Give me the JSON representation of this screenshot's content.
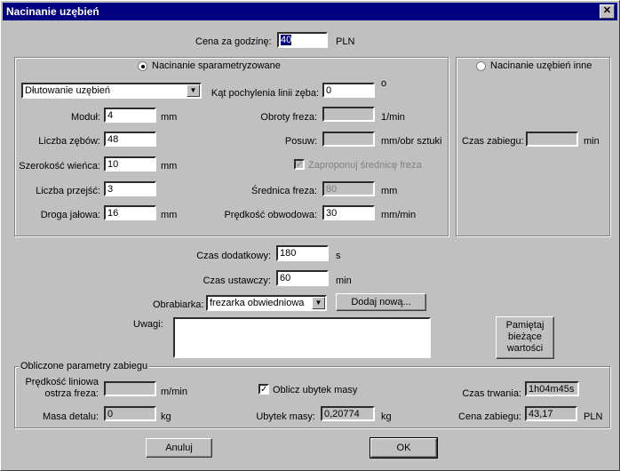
{
  "window": {
    "title": "Nacinanie uzębień",
    "close_glyph": "✕"
  },
  "cena": {
    "label": "Cena za godzinę:",
    "value": "40",
    "unit": "PLN"
  },
  "param_group": {
    "radio_label": "Nacinanie sparametryzowane",
    "method": "Dłutowanie uzębień",
    "kat_label": "Kąt pochylenia linii zęba:",
    "kat_value": "0",
    "kat_unit": "o",
    "modul_label": "Moduł:",
    "modul_value": "4",
    "modul_unit": "mm",
    "obroty_label": "Obroty freza:",
    "obroty_value": "",
    "obroty_unit": "1/min",
    "liczba_zebow_label": "Liczba zębów:",
    "liczba_zebow_value": "48",
    "posuw_label": "Posuw:",
    "posuw_value": "",
    "posuw_unit": "mm/obr sztuki",
    "szerokosc_label": "Szerokość wieńca:",
    "szerokosc_value": "10",
    "szerokosc_unit": "mm",
    "zaproponuj_label": "Zaproponuj średnicę freza",
    "przejsc_label": "Liczba przejść:",
    "przejsc_value": "3",
    "srednica_label": "Średnica freza:",
    "srednica_value": "80",
    "srednica_unit": "mm",
    "droga_label": "Droga jałowa:",
    "droga_value": "16",
    "droga_unit": "mm",
    "predkosc_label": "Prędkość obwodowa:",
    "predkosc_value": "30",
    "predkosc_unit": "mm/min"
  },
  "other_group": {
    "radio_label": "Nacinanie uzębień inne",
    "czas_label": "Czas zabiegu:",
    "czas_value": "",
    "czas_unit": "min"
  },
  "middle": {
    "dodatkowy_label": "Czas dodatkowy:",
    "dodatkowy_value": "180",
    "dodatkowy_unit": "s",
    "ustawczy_label": "Czas ustawczy:",
    "ustawczy_value": "60",
    "ustawczy_unit": "min",
    "obrabiarka_label": "Obrabiarka:",
    "obrabiarka_value": "frezarka obwiedniowa",
    "dodaj_label": "Dodaj nową...",
    "uwagi_label": "Uwagi:",
    "uwagi_value": "",
    "pamietaj_label_1": "Pamiętaj",
    "pamietaj_label_2": "bieżące",
    "pamietaj_label_3": "wartości"
  },
  "results": {
    "group_label": "Obliczone parametry zabiegu",
    "predkosc_label_1": "Prędkość liniowa",
    "predkosc_label_2": "ostrza freza:",
    "predkosc_value": "",
    "predkosc_unit": "m/min",
    "oblicz_label": "Oblicz ubytek masy",
    "czas_label": "Czas trwania:",
    "czas_value": "1h04m45s",
    "masa_label": "Masa detalu:",
    "masa_value": "0",
    "masa_unit": "kg",
    "ubytek_label": "Ubytek masy:",
    "ubytek_value": "0,20774",
    "ubytek_unit": "kg",
    "cena_label": "Cena zabiegu:",
    "cena_value": "43,17",
    "cena_unit": "PLN"
  },
  "buttons": {
    "anuluj": "Anuluj",
    "ok": "OK"
  },
  "icons": {
    "dropdown": "▼",
    "check": "✓"
  }
}
